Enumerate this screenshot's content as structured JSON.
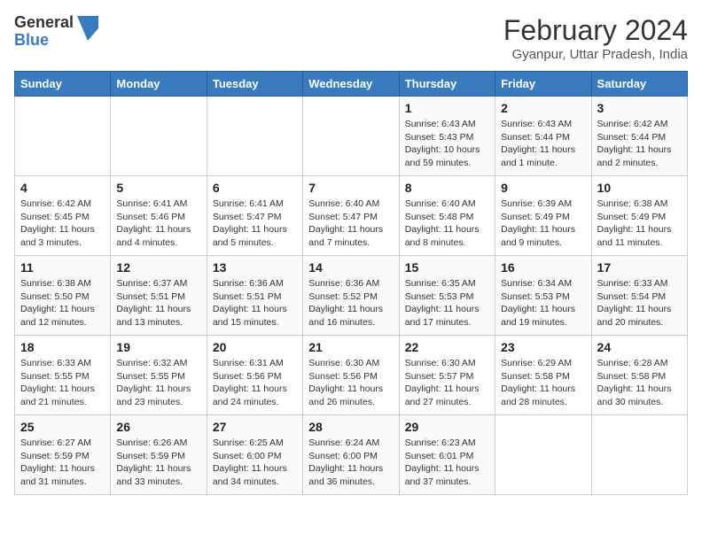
{
  "logo": {
    "general": "General",
    "blue": "Blue"
  },
  "title": "February 2024",
  "subtitle": "Gyanpur, Uttar Pradesh, India",
  "days_of_week": [
    "Sunday",
    "Monday",
    "Tuesday",
    "Wednesday",
    "Thursday",
    "Friday",
    "Saturday"
  ],
  "weeks": [
    [
      {
        "day": "",
        "info": ""
      },
      {
        "day": "",
        "info": ""
      },
      {
        "day": "",
        "info": ""
      },
      {
        "day": "",
        "info": ""
      },
      {
        "day": "1",
        "info": "Sunrise: 6:43 AM\nSunset: 5:43 PM\nDaylight: 10 hours and 59 minutes."
      },
      {
        "day": "2",
        "info": "Sunrise: 6:43 AM\nSunset: 5:44 PM\nDaylight: 11 hours and 1 minute."
      },
      {
        "day": "3",
        "info": "Sunrise: 6:42 AM\nSunset: 5:44 PM\nDaylight: 11 hours and 2 minutes."
      }
    ],
    [
      {
        "day": "4",
        "info": "Sunrise: 6:42 AM\nSunset: 5:45 PM\nDaylight: 11 hours and 3 minutes."
      },
      {
        "day": "5",
        "info": "Sunrise: 6:41 AM\nSunset: 5:46 PM\nDaylight: 11 hours and 4 minutes."
      },
      {
        "day": "6",
        "info": "Sunrise: 6:41 AM\nSunset: 5:47 PM\nDaylight: 11 hours and 5 minutes."
      },
      {
        "day": "7",
        "info": "Sunrise: 6:40 AM\nSunset: 5:47 PM\nDaylight: 11 hours and 7 minutes."
      },
      {
        "day": "8",
        "info": "Sunrise: 6:40 AM\nSunset: 5:48 PM\nDaylight: 11 hours and 8 minutes."
      },
      {
        "day": "9",
        "info": "Sunrise: 6:39 AM\nSunset: 5:49 PM\nDaylight: 11 hours and 9 minutes."
      },
      {
        "day": "10",
        "info": "Sunrise: 6:38 AM\nSunset: 5:49 PM\nDaylight: 11 hours and 11 minutes."
      }
    ],
    [
      {
        "day": "11",
        "info": "Sunrise: 6:38 AM\nSunset: 5:50 PM\nDaylight: 11 hours and 12 minutes."
      },
      {
        "day": "12",
        "info": "Sunrise: 6:37 AM\nSunset: 5:51 PM\nDaylight: 11 hours and 13 minutes."
      },
      {
        "day": "13",
        "info": "Sunrise: 6:36 AM\nSunset: 5:51 PM\nDaylight: 11 hours and 15 minutes."
      },
      {
        "day": "14",
        "info": "Sunrise: 6:36 AM\nSunset: 5:52 PM\nDaylight: 11 hours and 16 minutes."
      },
      {
        "day": "15",
        "info": "Sunrise: 6:35 AM\nSunset: 5:53 PM\nDaylight: 11 hours and 17 minutes."
      },
      {
        "day": "16",
        "info": "Sunrise: 6:34 AM\nSunset: 5:53 PM\nDaylight: 11 hours and 19 minutes."
      },
      {
        "day": "17",
        "info": "Sunrise: 6:33 AM\nSunset: 5:54 PM\nDaylight: 11 hours and 20 minutes."
      }
    ],
    [
      {
        "day": "18",
        "info": "Sunrise: 6:33 AM\nSunset: 5:55 PM\nDaylight: 11 hours and 21 minutes."
      },
      {
        "day": "19",
        "info": "Sunrise: 6:32 AM\nSunset: 5:55 PM\nDaylight: 11 hours and 23 minutes."
      },
      {
        "day": "20",
        "info": "Sunrise: 6:31 AM\nSunset: 5:56 PM\nDaylight: 11 hours and 24 minutes."
      },
      {
        "day": "21",
        "info": "Sunrise: 6:30 AM\nSunset: 5:56 PM\nDaylight: 11 hours and 26 minutes."
      },
      {
        "day": "22",
        "info": "Sunrise: 6:30 AM\nSunset: 5:57 PM\nDaylight: 11 hours and 27 minutes."
      },
      {
        "day": "23",
        "info": "Sunrise: 6:29 AM\nSunset: 5:58 PM\nDaylight: 11 hours and 28 minutes."
      },
      {
        "day": "24",
        "info": "Sunrise: 6:28 AM\nSunset: 5:58 PM\nDaylight: 11 hours and 30 minutes."
      }
    ],
    [
      {
        "day": "25",
        "info": "Sunrise: 6:27 AM\nSunset: 5:59 PM\nDaylight: 11 hours and 31 minutes."
      },
      {
        "day": "26",
        "info": "Sunrise: 6:26 AM\nSunset: 5:59 PM\nDaylight: 11 hours and 33 minutes."
      },
      {
        "day": "27",
        "info": "Sunrise: 6:25 AM\nSunset: 6:00 PM\nDaylight: 11 hours and 34 minutes."
      },
      {
        "day": "28",
        "info": "Sunrise: 6:24 AM\nSunset: 6:00 PM\nDaylight: 11 hours and 36 minutes."
      },
      {
        "day": "29",
        "info": "Sunrise: 6:23 AM\nSunset: 6:01 PM\nDaylight: 11 hours and 37 minutes."
      },
      {
        "day": "",
        "info": ""
      },
      {
        "day": "",
        "info": ""
      }
    ]
  ]
}
